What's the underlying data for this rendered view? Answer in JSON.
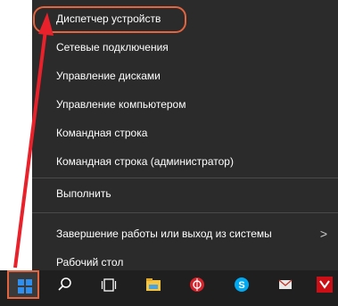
{
  "context_menu": {
    "items": [
      {
        "label": "Диспетчер устройств"
      },
      {
        "label": "Сетевые подключения"
      },
      {
        "label": "Управление дисками"
      },
      {
        "label": "Управление компьютером"
      },
      {
        "label": "Командная строка"
      },
      {
        "label": "Командная строка (администратор)"
      },
      {
        "label": "Выполнить"
      },
      {
        "label": "Завершение работы или выход из системы",
        "submenu_arrow": ">"
      },
      {
        "label": "Рабочий стол"
      }
    ]
  },
  "taskbar": {
    "icons": [
      "windows-logo-icon",
      "search-icon",
      "task-view-icon",
      "file-explorer-icon",
      "antivirus-icon",
      "skype-icon",
      "mail-icon",
      "opera-icon"
    ]
  },
  "colors": {
    "menu_bg": "#2b2b2b",
    "highlight": "#e3643f",
    "arrow": "#e8212b",
    "taskbar_bg": "#1f1f1f"
  }
}
